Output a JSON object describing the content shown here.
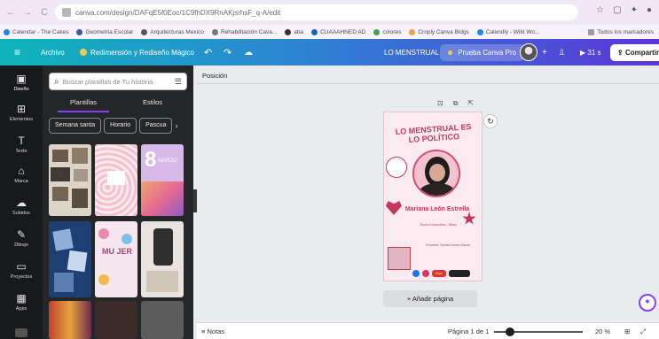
{
  "browser": {
    "url": "canva.com/design/DAFqE5f0Eoc/1C9fhDX9RnAKjsrhsF_q-A/edit",
    "bookmarks": [
      "Calendar - The Cakes",
      "Geometria Escolar",
      "Arquitecturas Mexico",
      "Rehabilitación Cava...",
      "aba",
      "CUAAAHNED AD",
      "colores",
      "Croply Canva Bldgs",
      "Calendly - Wild Wo...",
      "Todos los marcadores"
    ]
  },
  "canva_top": {
    "menu_icon": "hamburger-icon",
    "file_label": "Archivo",
    "resize_label": "Redimensión y Rediseño Mágico",
    "doc_title": "LO MENSTRUAL",
    "pro_label": "Prueba Canva Pro",
    "plus": "+",
    "present_label": "▶ 31 s",
    "share_label": "Compartir"
  },
  "rail": {
    "items": [
      {
        "label": "Diseño",
        "icon": "layout-icon"
      },
      {
        "label": "Elementos",
        "icon": "shapes-icon"
      },
      {
        "label": "Texto",
        "icon": "text-icon"
      },
      {
        "label": "Marca",
        "icon": "brand-icon"
      },
      {
        "label": "Subidos",
        "icon": "cloud-upload-icon"
      },
      {
        "label": "Dibujo",
        "icon": "draw-icon"
      },
      {
        "label": "Proyectos",
        "icon": "folder-icon"
      },
      {
        "label": "Apps",
        "icon": "apps-icon"
      }
    ]
  },
  "panel": {
    "search_placeholder": "Buscar plantillas de Tu historia",
    "tabs": [
      "Plantillas",
      "Estilos"
    ],
    "chips": [
      "Semana santa",
      "Horario",
      "Pascua"
    ],
    "thumb_texts": {
      "marzo_number": "8",
      "marzo_word": "MARZO",
      "mujer": "MU JER"
    }
  },
  "canvas": {
    "position_label": "Posición",
    "design": {
      "title": "LO MENSTRUAL ES LO POLÍTICO",
      "name": "Mariana León Estrella",
      "subtitle": "Socia fundadora - Mala",
      "host": "Presenta: Cecilia Gomez Garcia",
      "live": "Live"
    },
    "add_page": "+ Añadir página"
  },
  "bottom": {
    "notes": "Notas",
    "pages": "Página 1 de 1",
    "zoom": "20 %"
  }
}
